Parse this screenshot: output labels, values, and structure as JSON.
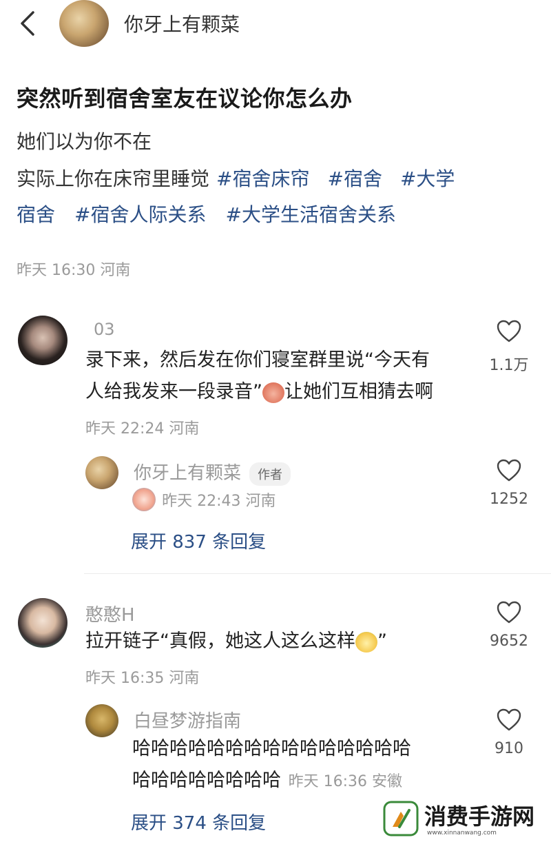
{
  "header": {
    "username": "你牙上有颗菜"
  },
  "post": {
    "title": "突然听到宿舍室友在议论你怎么办",
    "line1": "她们以为你不在",
    "line2_text": "实际上你在床帘里睡觉",
    "tags_line2": [
      "#宿舍床帘",
      "#宿舍",
      "#大学"
    ],
    "tags_line3": [
      "宿舍",
      "#宿舍人际关系",
      "#大学生活宿舍关系"
    ],
    "meta": "昨天 16:30 河南"
  },
  "comments": [
    {
      "name": "03",
      "text_line1": "录下来，然后发在你们寝室群里说“今天有",
      "text_line2a": "人给我发来一段录音”",
      "text_line2b": "让她们互相猜去啊",
      "meta": "昨天 22:24 河南",
      "likes": "1.1万",
      "reply": {
        "name": "你牙上有颗菜",
        "badge": "作者",
        "meta": "昨天 22:43 河南",
        "likes": "1252"
      },
      "expand": "展开 837 条回复"
    },
    {
      "name": "憨憨H",
      "text_a": "拉开链子“真假，她这人这么这样",
      "text_b": "”",
      "meta": "昨天 16:35 河南",
      "likes": "9652",
      "reply": {
        "name": "白昼梦游指南",
        "text_line1": "哈哈哈哈哈哈哈哈哈哈哈哈哈哈哈",
        "text_line2": "哈哈哈哈哈哈哈哈",
        "meta": "昨天 16:36 安徽",
        "likes": "910"
      },
      "expand": "展开 374 条回复"
    }
  ],
  "watermark": {
    "text": "消费手游网",
    "url": "www.xinnanwang.com"
  },
  "colors": {
    "tag": "#2b4f86",
    "meta": "#9a9a9a"
  }
}
